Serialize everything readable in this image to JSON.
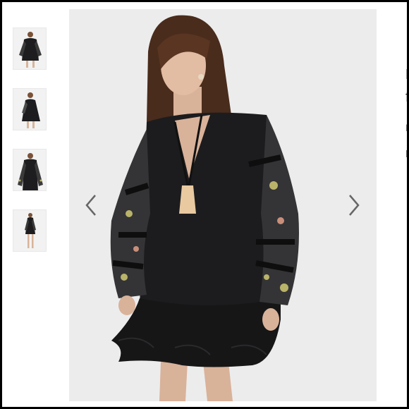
{
  "gallery": {
    "thumbnails": [
      {
        "name": "thumbnail-1"
      },
      {
        "name": "thumbnail-2"
      },
      {
        "name": "thumbnail-3"
      },
      {
        "name": "thumbnail-4"
      }
    ],
    "prev_icon": "chevron-left-icon",
    "next_icon": "chevron-right-icon"
  },
  "side_panel": {
    "line1": "F",
    "line2": "f",
    "line3": "F",
    "accent_color": "#d6336c"
  },
  "colors": {
    "background": "#ffffff",
    "main_bg": "#ececec",
    "dress": "#1c1c1e",
    "arrow": "#666666"
  }
}
